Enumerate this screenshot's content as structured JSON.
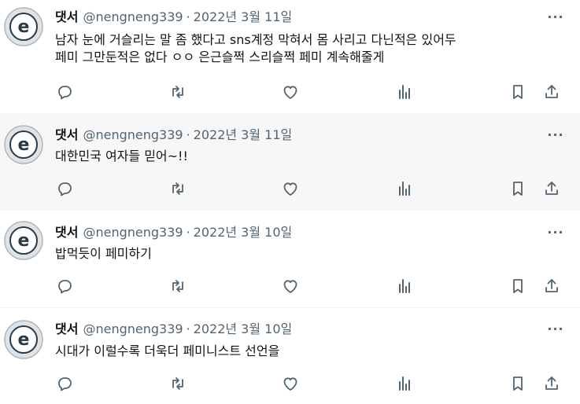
{
  "tweets": [
    {
      "name": "댓서",
      "handle": "@nengneng339",
      "date": "2022년 3월 11일",
      "text": "남자 눈에 거슬리는 말 좀 했다고 sns계정 막혀서 몸 사리고 다닌적은 있어두\n페미 그만둔적은 없다 ㅇㅇ 은근슬쩍 스리슬쩍 페미 계속해줄게"
    },
    {
      "name": "댓서",
      "handle": "@nengneng339",
      "date": "2022년 3월 11일",
      "text": "대한민국 여자들 믿어~!!"
    },
    {
      "name": "댓서",
      "handle": "@nengneng339",
      "date": "2022년 3월 10일",
      "text": "밥먹듯이 페미하기"
    },
    {
      "name": "댓서",
      "handle": "@nengneng339",
      "date": "2022년 3월 10일",
      "text": "시대가 이럴수록 더욱더 페미니스트 선언을"
    }
  ],
  "dot_separator": "·",
  "more_label": "···",
  "icons": [
    "reply-icon",
    "retweet-icon",
    "like-icon",
    "views-icon",
    "bookmark-icon",
    "share-icon"
  ],
  "colors": {
    "text": "#0f1419",
    "secondary": "#536471",
    "divider": "#eff3f4",
    "highlight_bg": "#f7f7f7"
  }
}
